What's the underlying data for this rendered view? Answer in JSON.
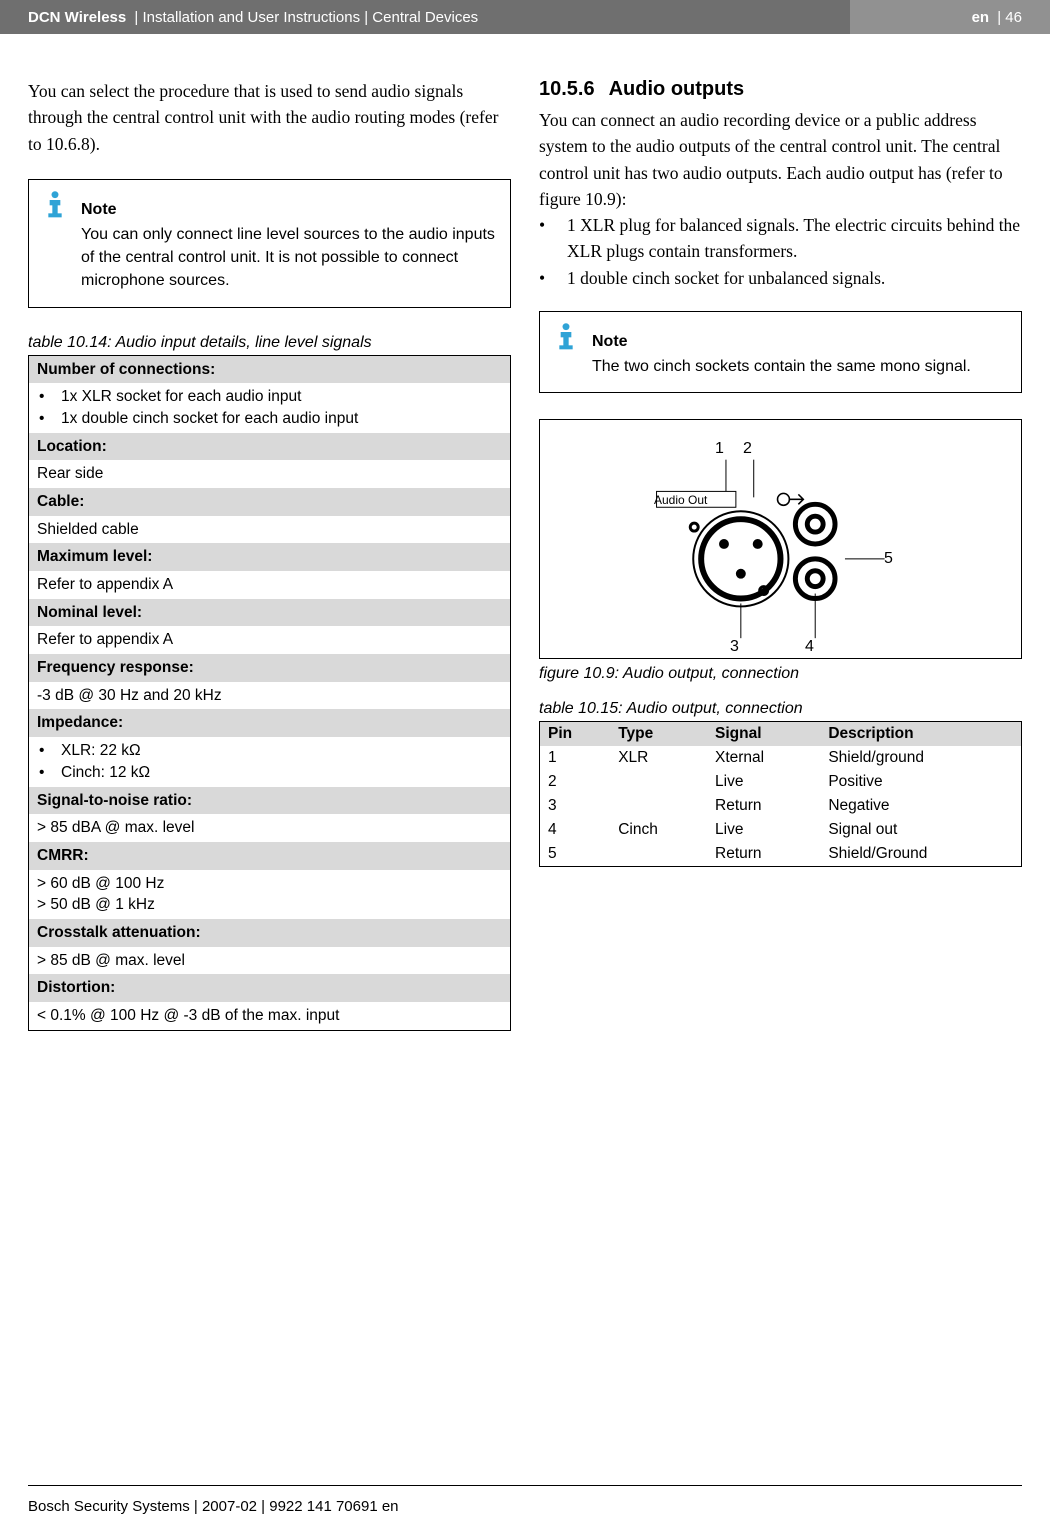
{
  "header": {
    "product": "DCN Wireless",
    "crumbs": " | Installation and User Instructions | Central Devices",
    "lang": "en",
    "page": " | 46"
  },
  "left": {
    "intro": "You can select the procedure that is used to send audio signals through the central control unit with the audio routing modes (refer to 10.6.8).",
    "note_title": "Note",
    "note_body": "You can only connect line level sources to the audio inputs of the central control unit. It is not possible to connect microphone sources.",
    "table_caption": "table 10.14: Audio input details, line level signals",
    "specs": {
      "h_num": "Number of connections:",
      "num_1": "1x XLR socket for each audio input",
      "num_2": "1x double cinch socket for each audio input",
      "h_loc": "Location:",
      "loc_v": "Rear side",
      "h_cable": "Cable:",
      "cable_v": "Shielded cable",
      "h_max": "Maximum level:",
      "max_v": "Refer to appendix A",
      "h_nom": "Nominal level:",
      "nom_v": "Refer to appendix A",
      "h_freq": "Frequency response:",
      "freq_v": "-3 dB @ 30 Hz and 20 kHz",
      "h_imp": "Impedance:",
      "imp_1": "XLR: 22 kΩ",
      "imp_2": "Cinch: 12 kΩ",
      "h_snr": "Signal-to-noise ratio:",
      "snr_v": "> 85 dBA @ max. level",
      "h_cmrr": "CMRR:",
      "cmrr_1": "> 60 dB @ 100 Hz",
      "cmrr_2": "> 50 dB @ 1 kHz",
      "h_xtalk": "Crosstalk attenuation:",
      "xtalk_v": "> 85 dB @ max. level",
      "h_dist": "Distortion:",
      "dist_v": "< 0.1% @ 100 Hz @ -3 dB of the max. input"
    }
  },
  "right": {
    "sec_num": "10.5.6",
    "sec_title": "Audio outputs",
    "para": "You can connect an audio recording device or a public address system to the audio outputs of the central control unit. The central control unit has two audio outputs. Each audio output has (refer to figure 10.9):",
    "b1": "1 XLR plug for balanced signals. The electric circuits behind the XLR plugs contain transformers.",
    "b2": "1 double cinch socket for unbalanced signals.",
    "note_title": "Note",
    "note_body": "The two cinch sockets contain the same mono signal.",
    "fig_label_audio": "Audio Out",
    "fig_caption": "figure 10.9: Audio output, connection",
    "fig_num_1": "1",
    "fig_num_2": "2",
    "fig_num_3": "3",
    "fig_num_4": "4",
    "fig_num_5": "5",
    "conn_caption": "table 10.15: Audio output, connection",
    "conn": {
      "h_pin": "Pin",
      "h_type": "Type",
      "h_sig": "Signal",
      "h_desc": "Description",
      "r1p": "1",
      "r1t": "XLR",
      "r1s": "Xternal",
      "r1d": "Shield/ground",
      "r2p": "2",
      "r2t": "",
      "r2s": "Live",
      "r2d": "Positive",
      "r3p": "3",
      "r3t": "",
      "r3s": "Return",
      "r3d": "Negative",
      "r4p": "4",
      "r4t": "Cinch",
      "r4s": "Live",
      "r4d": "Signal out",
      "r5p": "5",
      "r5t": "",
      "r5s": "Return",
      "r5d": "Shield/Ground"
    }
  },
  "footer": "Bosch Security Systems | 2007-02 | 9922 141 70691 en"
}
